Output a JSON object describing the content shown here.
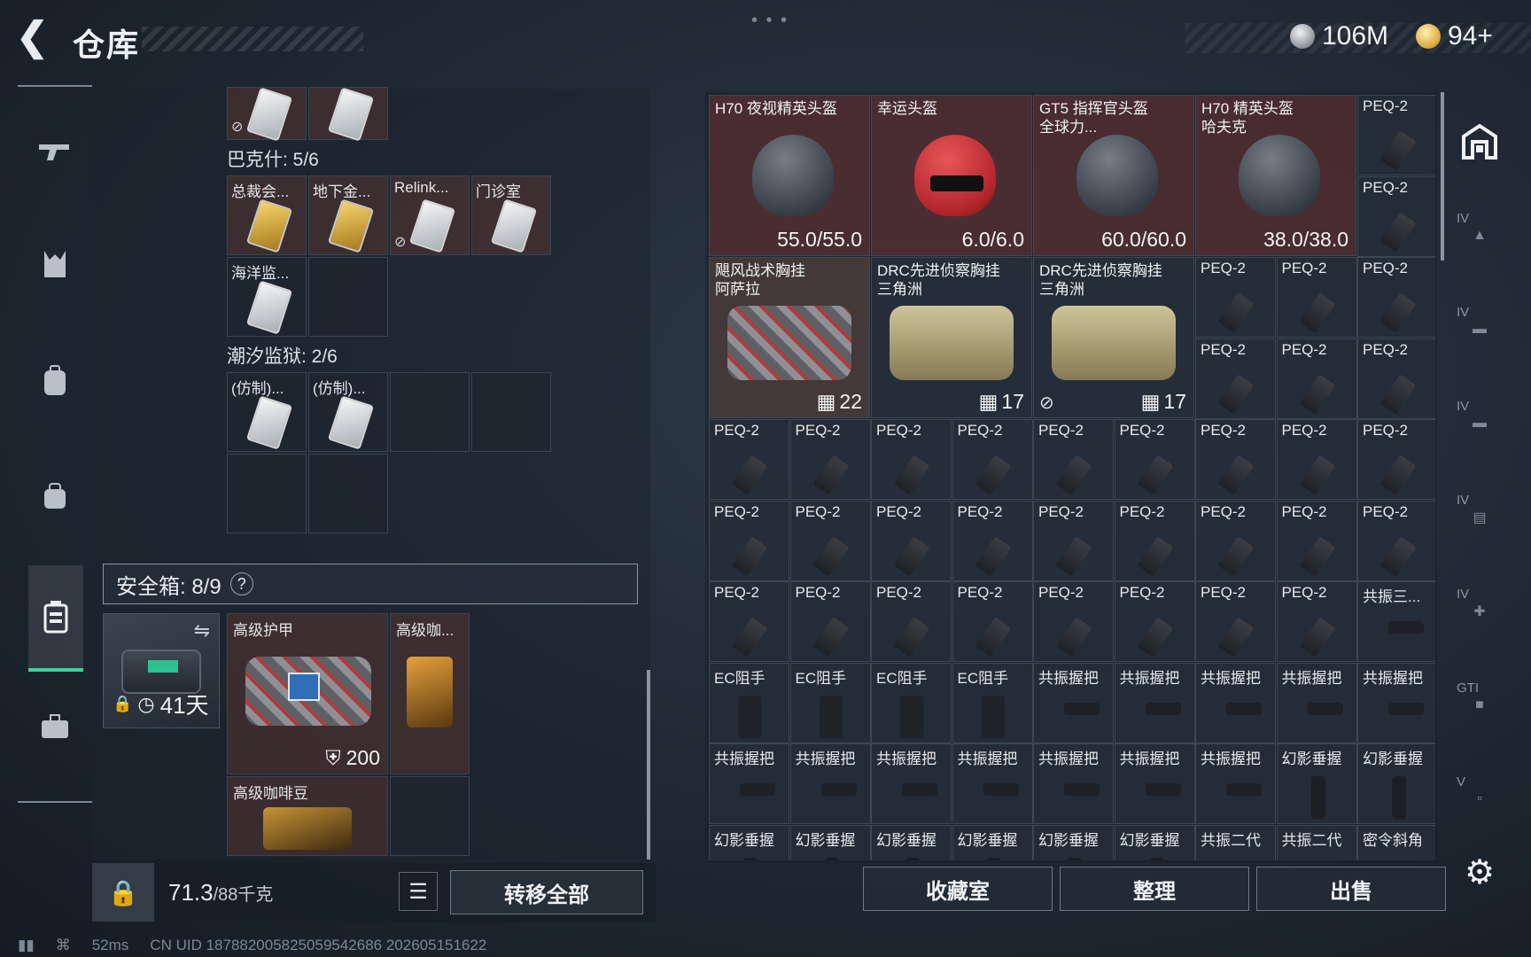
{
  "header": {
    "title": "仓库",
    "currency_silver": "106M",
    "currency_gold": "94+"
  },
  "left_nav": [
    "gun-icon",
    "armor-icon",
    "backpack-icon",
    "bag-icon",
    "safebox-icon",
    "briefcase-icon"
  ],
  "stash_sections": [
    {
      "title": "巴克什: 5/6",
      "items": [
        "总裁会...",
        "地下金...",
        "Relink...",
        "门诊室",
        "海洋监..."
      ]
    },
    {
      "title": "潮汐监狱: 2/6",
      "items": [
        "(仿制)...",
        "(仿制)..."
      ]
    }
  ],
  "safebox": {
    "title": "安全箱: 8/9",
    "help": "?",
    "duration": "41天",
    "armor_label": "高级护甲",
    "armor_value": "200",
    "coffee_label": "高级咖...",
    "coffee_beans_label": "高级咖啡豆"
  },
  "bottom_left": {
    "weight_value": "71.3",
    "weight_limit": "/88千克",
    "transfer_all": "转移全部"
  },
  "grid_big": [
    {
      "label": "H70 夜视精英头盔",
      "value": "55.0/55.0"
    },
    {
      "label": "幸运头盔",
      "value": "6.0/6.0"
    },
    {
      "label": "GT5 指挥官头盔\n全球力...",
      "value": "60.0/60.0"
    },
    {
      "label": "H70 精英头盔\n哈夫克",
      "value": "38.0/38.0"
    },
    {
      "label": "飓风战术胸挂\n阿萨拉",
      "value": "22"
    },
    {
      "label": "DRC先进侦察胸挂\n三角洲",
      "value": "17"
    },
    {
      "label": "DRC先进侦察胸挂\n三角洲",
      "value": "17"
    }
  ],
  "grid_labels": {
    "peq": "PEQ-2",
    "ec": "EC阻手",
    "grip": "共振握把",
    "phantom": "幻影垂握",
    "resonance3": "共振三...",
    "res2": "共振二代",
    "secret": "密令斜角"
  },
  "bottom_right": {
    "collection": "收藏室",
    "organize": "整理",
    "sell": "出售"
  },
  "status": {
    "ping": "52ms",
    "uid": "CN UID 1878820058250595426​86 202605151622"
  }
}
